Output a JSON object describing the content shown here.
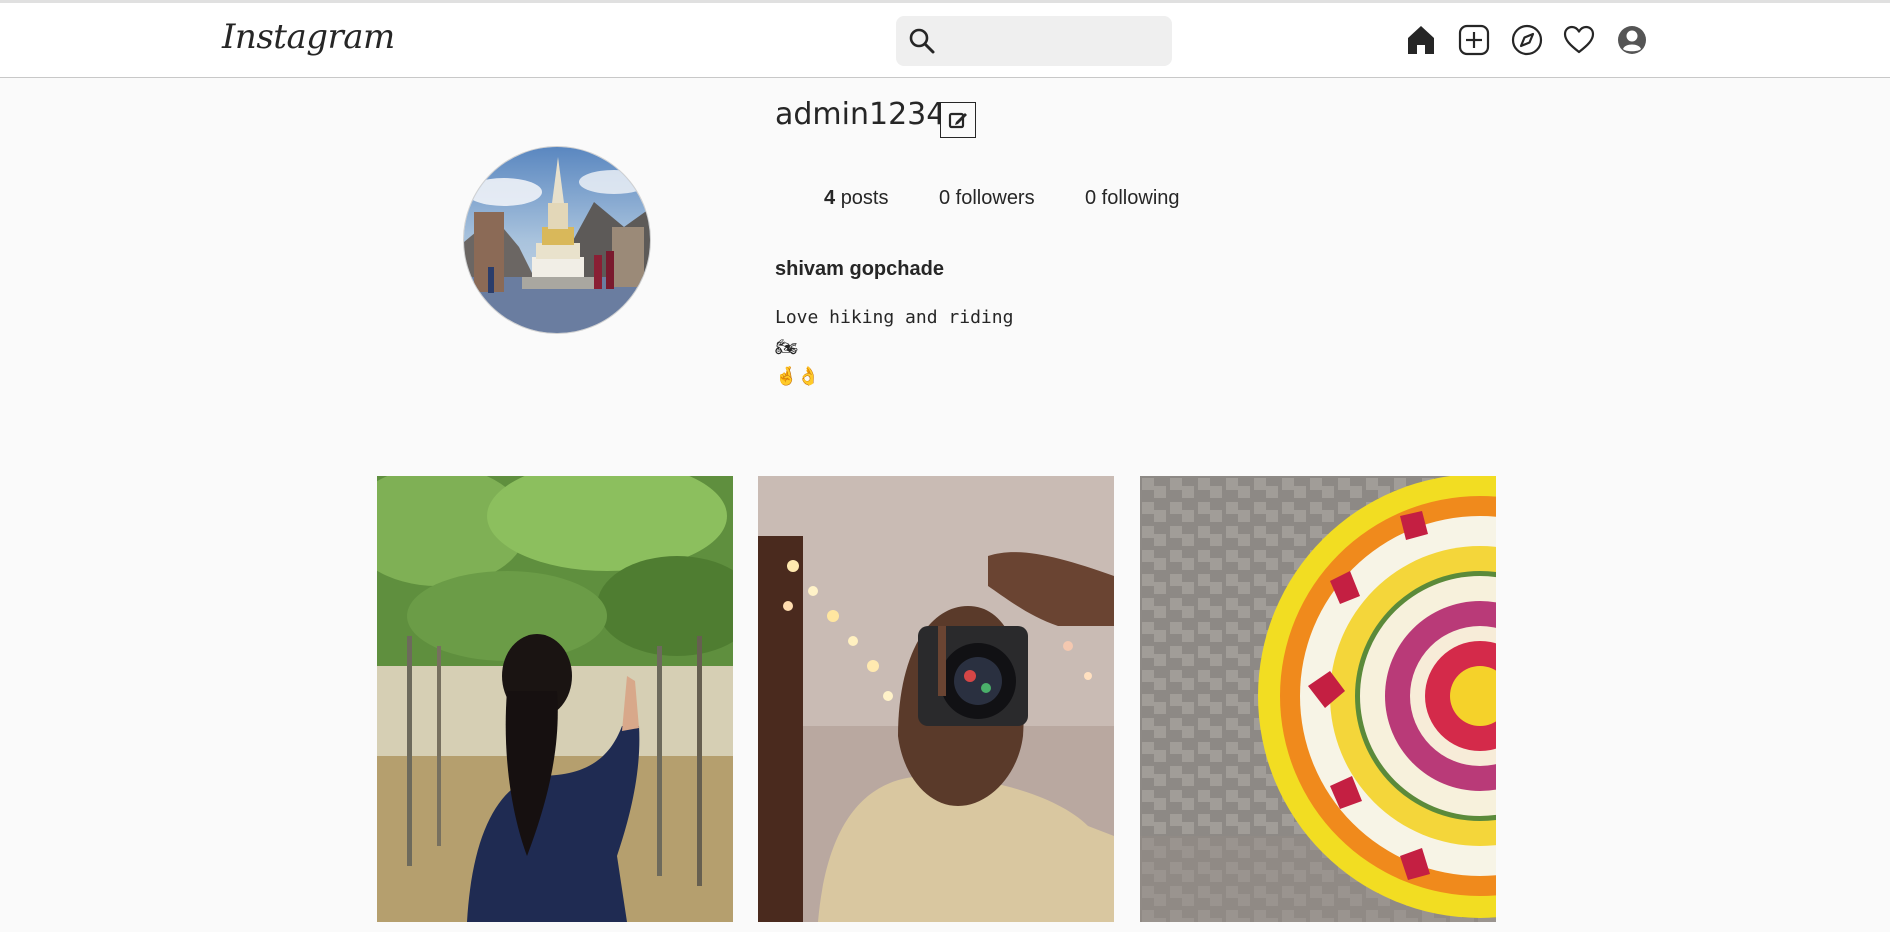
{
  "app": {
    "logo": "Instagram"
  },
  "search": {
    "placeholder": ""
  },
  "nav": {
    "icons": [
      "home-icon",
      "new-post-icon",
      "explore-icon",
      "activity-heart-icon",
      "profile-icon"
    ]
  },
  "profile": {
    "username": "admin1234",
    "posts_count": "4",
    "posts_label": "posts",
    "followers": "0 followers",
    "following": "0 following",
    "full_name": "shivam gopchade",
    "bio_line1": "Love hiking and riding",
    "bio_line2": "🏍",
    "bio_line3": "🤞👌"
  },
  "posts": [
    {
      "subject": "person-in-vineyard-photo"
    },
    {
      "subject": "camera-selfie-photo"
    },
    {
      "subject": "flower-rangoli-photo"
    }
  ],
  "colors": {
    "text": "#262626",
    "background": "#fafafa",
    "navbar": "#ffffff",
    "search_bg": "#efefef"
  }
}
